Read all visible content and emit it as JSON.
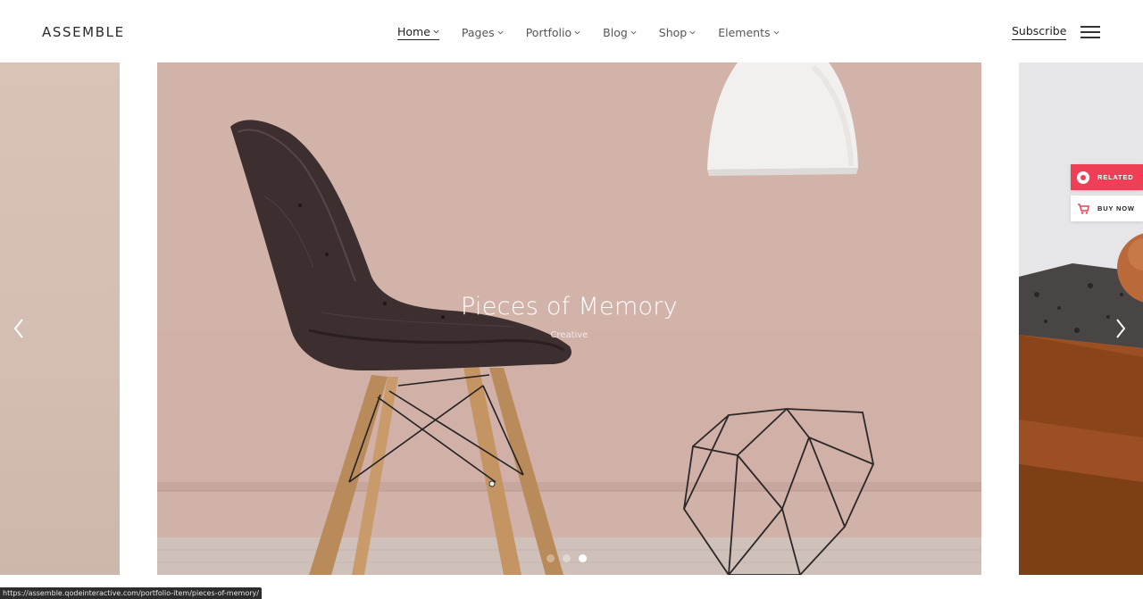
{
  "header": {
    "logo": "ASSEMBLE",
    "nav": [
      {
        "label": "Home",
        "active": true
      },
      {
        "label": "Pages"
      },
      {
        "label": "Portfolio"
      },
      {
        "label": "Blog"
      },
      {
        "label": "Shop"
      },
      {
        "label": "Elements"
      }
    ],
    "subscribe_label": "Subscribe",
    "menu_icon": "hamburger-icon"
  },
  "slider": {
    "title": "Pieces of Memory",
    "category": "Creative",
    "prev_icon": "chevron-left-icon",
    "next_icon": "chevron-right-icon",
    "dots_total": 3,
    "dots_active_index": 2
  },
  "floating": {
    "related_label": "RELATED",
    "buy_label": "BUY NOW",
    "accent": "#ef3f57"
  },
  "statusbar": {
    "url": "https://assemble.qodeinteractive.com/portfolio-item/pieces-of-memory/"
  }
}
